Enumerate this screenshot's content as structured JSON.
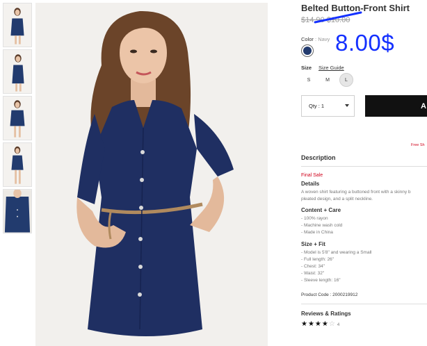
{
  "product": {
    "title": "Belted Button-Front Shirt",
    "old_price": "$14.90 $10.00",
    "new_price": "8.00$",
    "color_label": "Color",
    "color_value": ": Navy",
    "swatch_color": "#223b6e",
    "size_label": "Size",
    "size_guide": "Size Guide",
    "sizes": [
      "S",
      "M",
      "L"
    ],
    "selected_size": "L",
    "qty_label": "Qty : 1",
    "add_label": "A",
    "free_shipping": "Free Sh"
  },
  "description": {
    "title": "Description",
    "final_sale": "Final Sale",
    "details_h": "Details",
    "details_1": "A woven shirt featuring a buttoned front with a skinny b",
    "details_2": "pleated design, and a split neckline.",
    "content_h": "Content + Care",
    "content_1": "- 100% rayon",
    "content_2": "- Machine wash cold",
    "content_3": "- Made in China",
    "fit_h": "Size + Fit",
    "fit_1": "- Model is 5'8\" and wearing a Small",
    "fit_2": "- Full length: 26\"",
    "fit_3": "- Chest: 34\"",
    "fit_4": "- Waist: 32\"",
    "fit_5": "- Sleeve length: 16\"",
    "product_code": "Product Code : 2000219912"
  },
  "reviews": {
    "title": "Reviews & Ratings",
    "stars_filled": "★★★★",
    "stars_empty": "☆",
    "count": "4",
    "rating": 4,
    "max_rating": 5
  },
  "colors": {
    "accent_blue": "#1430ff",
    "sale_red": "#d0021b",
    "dress_navy": "#223b6e"
  }
}
